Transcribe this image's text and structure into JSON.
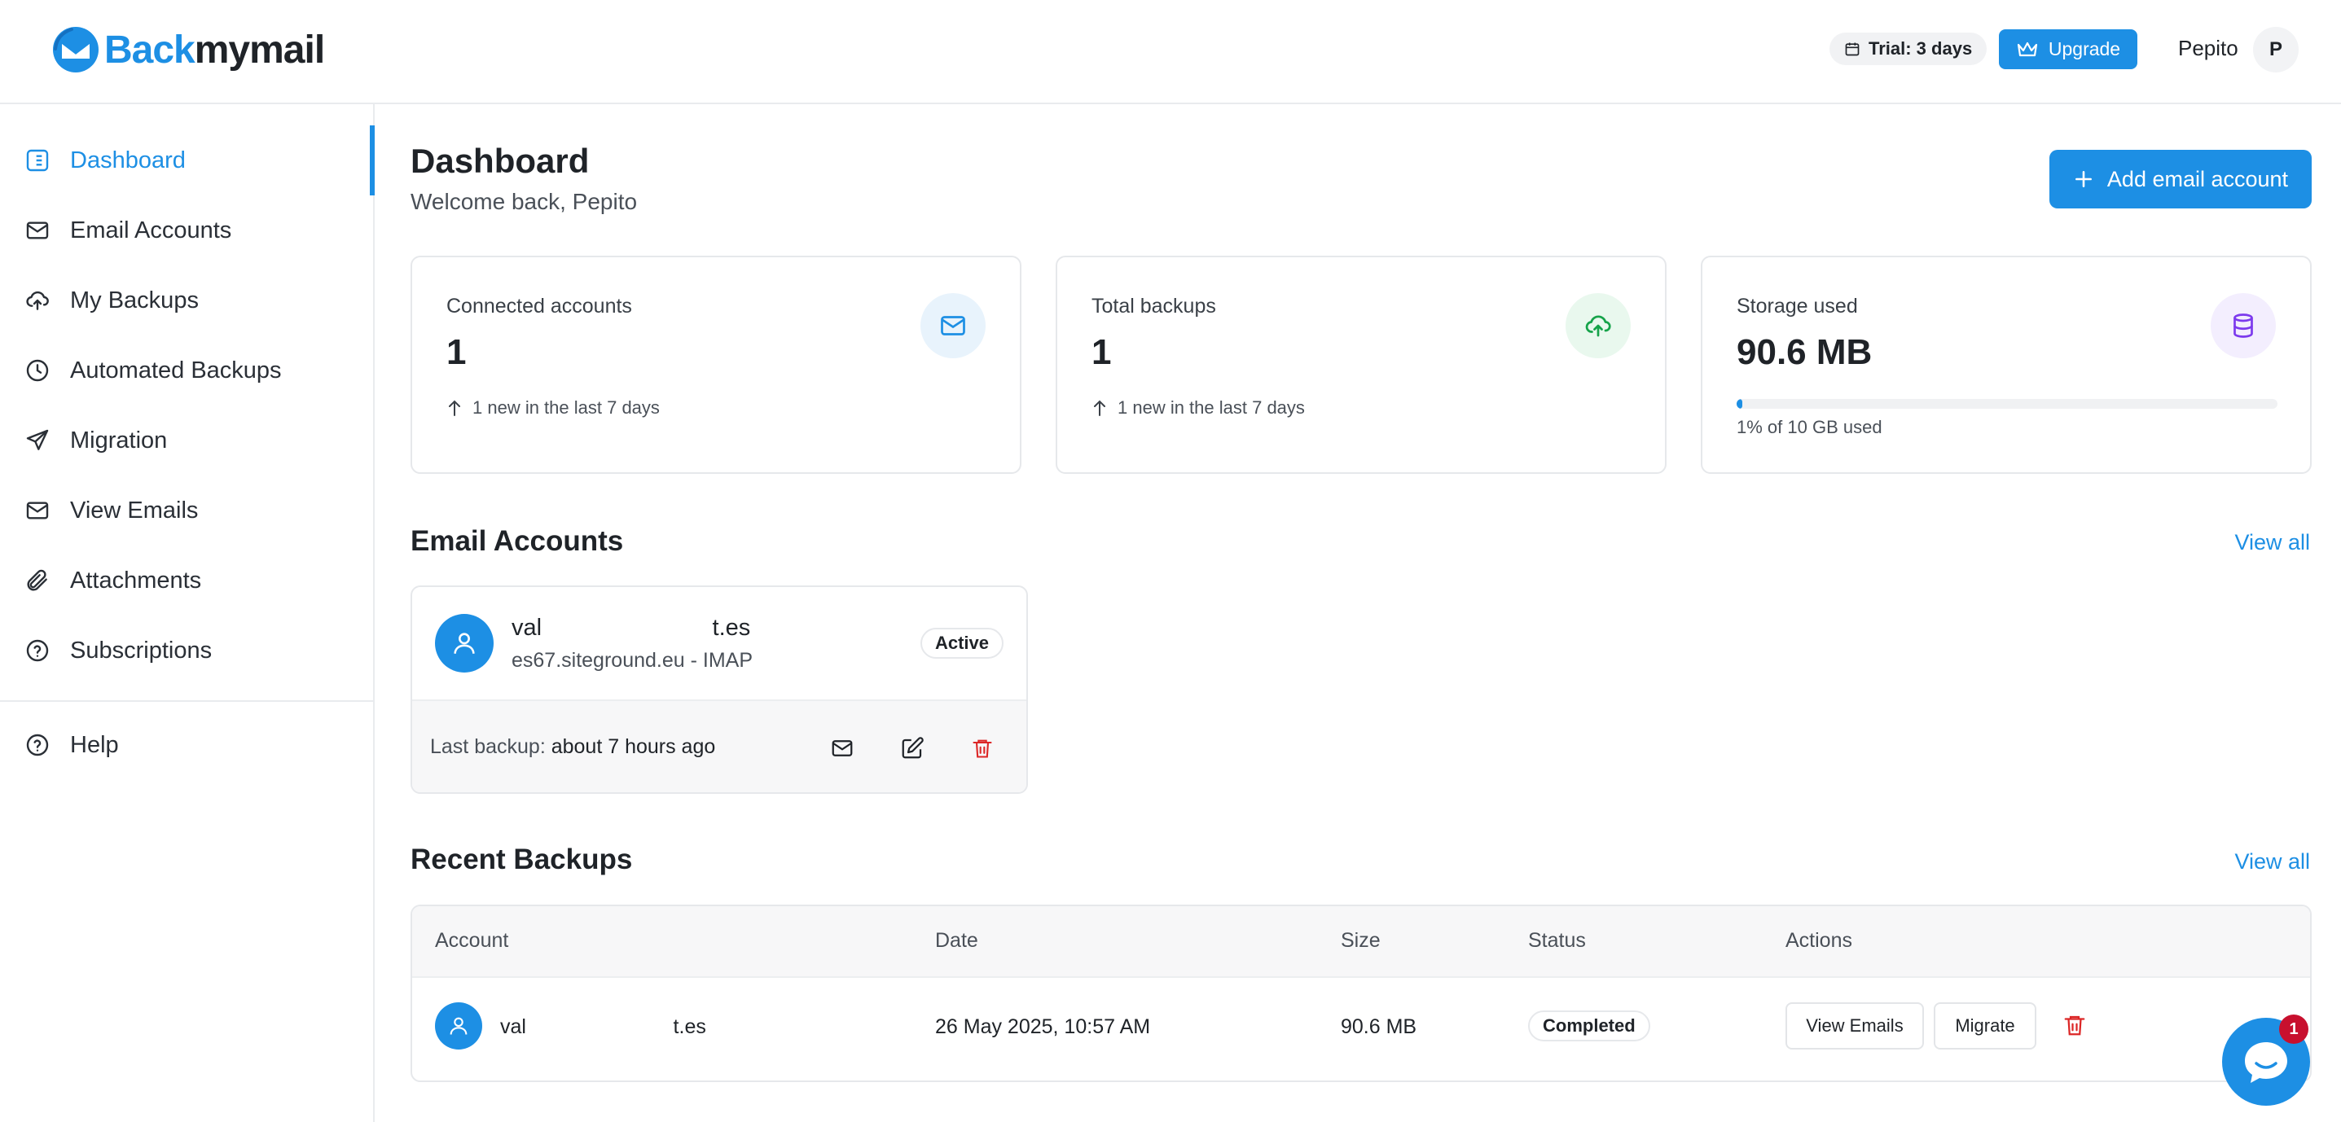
{
  "brand": {
    "part1": "Back",
    "part2": "mymail"
  },
  "header": {
    "trial_label": "Trial: 3 days",
    "upgrade_label": "Upgrade",
    "user_name": "Pepito",
    "user_initial": "P"
  },
  "sidebar": {
    "items": [
      {
        "label": "Dashboard",
        "icon": "list-icon",
        "active": true
      },
      {
        "label": "Email Accounts",
        "icon": "mail-icon"
      },
      {
        "label": "My Backups",
        "icon": "cloud-upload-icon"
      },
      {
        "label": "Automated Backups",
        "icon": "clock-icon"
      },
      {
        "label": "Migration",
        "icon": "send-icon"
      },
      {
        "label": "View Emails",
        "icon": "mail-icon"
      },
      {
        "label": "Attachments",
        "icon": "paperclip-icon"
      },
      {
        "label": "Subscriptions",
        "icon": "help-circle-icon"
      }
    ],
    "help_label": "Help"
  },
  "main": {
    "title": "Dashboard",
    "subtitle": "Welcome back, Pepito",
    "add_button": "Add email account"
  },
  "stats": {
    "connected": {
      "label": "Connected accounts",
      "value": "1",
      "note": "1 new in the last 7 days",
      "icon": "mail-icon"
    },
    "backups": {
      "label": "Total backups",
      "value": "1",
      "note": "1 new in the last 7 days",
      "icon": "cloud-upload-icon"
    },
    "storage": {
      "label": "Storage used",
      "value": "90.6 MB",
      "note": "1% of 10 GB used",
      "percent": 1,
      "icon": "database-icon"
    }
  },
  "email_accounts": {
    "title": "Email Accounts",
    "view_all": "View all",
    "account": {
      "name": "val                          t.es",
      "server": "es67.siteground.eu - IMAP",
      "status": "Active",
      "last_backup_label": "Last backup:",
      "last_backup_value": "about 7 hours ago"
    }
  },
  "recent_backups": {
    "title": "Recent Backups",
    "view_all": "View all",
    "columns": [
      "Account",
      "Date",
      "Size",
      "Status",
      "Actions"
    ],
    "rows": [
      {
        "account": "val                          t.es",
        "date": "26 May 2025, 10:57 AM",
        "size": "90.6 MB",
        "status": "Completed",
        "view_emails": "View Emails",
        "migrate": "Migrate"
      }
    ]
  },
  "chat": {
    "badge": "1"
  },
  "colors": {
    "accent": "#1d8fe4",
    "danger": "#dc2626",
    "success": "#16a34a",
    "purple": "#7c3aed"
  }
}
